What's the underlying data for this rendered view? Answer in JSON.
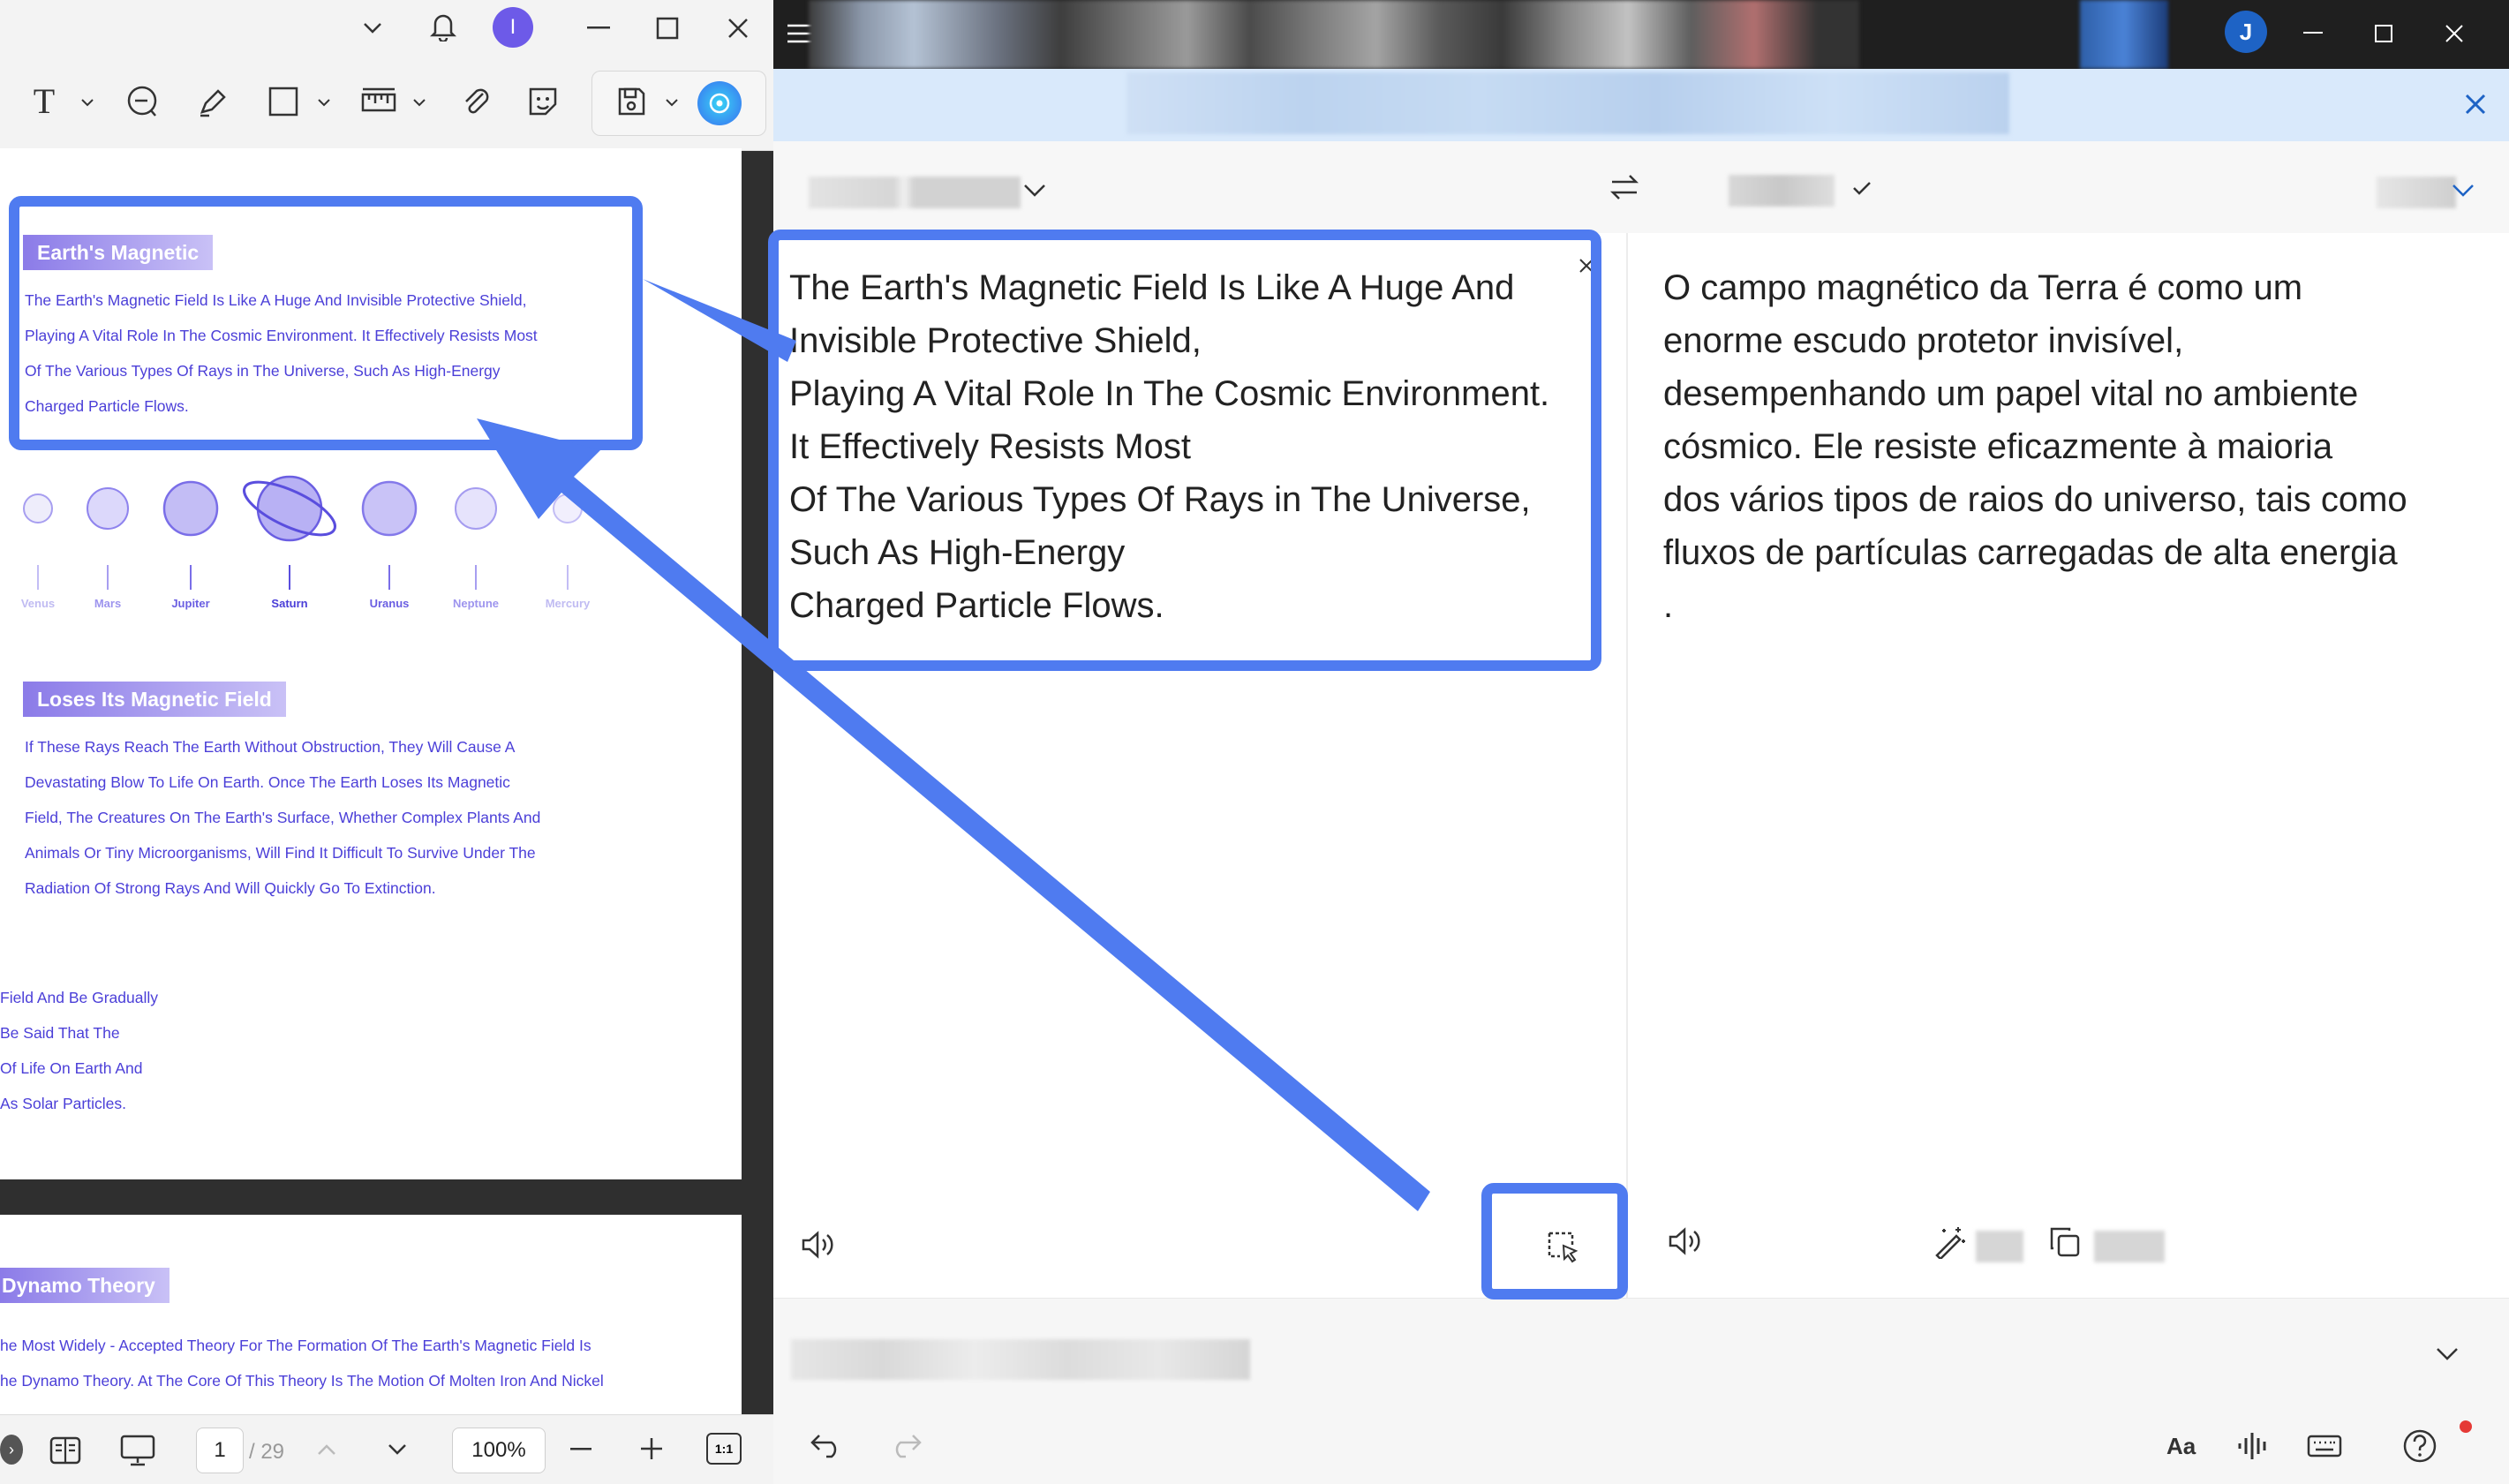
{
  "left_app": {
    "toolbar": {
      "text_tool": "T",
      "page_current": "1",
      "page_total": "/ 29",
      "zoom": "100%",
      "fit_label": "1:1",
      "profile_initial": "I"
    },
    "pdf": {
      "section1_title": "Earth's Magnetic",
      "section1_lines": [
        "The Earth's Magnetic Field Is Like A Huge And Invisible Protective Shield,",
        "Playing A Vital Role In The Cosmic Environment. It Effectively Resists Most",
        "Of The Various Types Of Rays in The Universe, Such As High-Energy",
        "Charged Particle Flows."
      ],
      "planets": [
        "Venus",
        "Mars",
        "Jupiter",
        "Saturn",
        "Uranus",
        "Neptune",
        "Mercury"
      ],
      "section2_title": "Loses Its Magnetic Field",
      "section2_lines": [
        "If These Rays Reach The Earth Without Obstruction, They Will Cause A",
        "Devastating Blow To Life On Earth. Once The Earth Loses Its Magnetic",
        "Field, The Creatures On The Earth's Surface, Whether Complex Plants And",
        "Animals Or Tiny Microorganisms, Will Find It Difficult To Survive Under The",
        "Radiation Of Strong Rays And Will Quickly Go To Extinction."
      ],
      "section3_lines": [
        "Field And Be Gradually",
        " Be Said That The",
        "Of Life On Earth And",
        " As Solar Particles."
      ],
      "section4_title": "Dynamo Theory",
      "section4_lines": [
        "he Most Widely - Accepted Theory For The Formation Of The Earth's Magnetic Field Is",
        "he Dynamo Theory. At The Core Of This Theory Is The Motion Of Molten Iron And Nickel"
      ]
    }
  },
  "right_app": {
    "profile_initial": "J",
    "source_lines": [
      "The Earth's Magnetic Field Is Like A Huge And",
      "Invisible Protective Shield,",
      "Playing A Vital Role In The Cosmic Environment.",
      "It Effectively Resists Most",
      "Of The Various Types Of Rays in The Universe,",
      "Such As High-Energy",
      "Charged Particle Flows."
    ],
    "target_lines": [
      "O campo magnético da Terra é como um",
      "enorme escudo protetor invisível,",
      "desempenhando um papel vital no ambiente",
      "cósmico. Ele resiste eficazmente à maioria",
      "dos vários tipos de raios do universo, tais como",
      "fluxos de partículas carregadas de alta energia",
      "."
    ],
    "font_size_label": "Aa"
  },
  "colors": {
    "highlight": "#4f7bf0",
    "pdf_text": "#4b3fd8",
    "chip_start": "#8b7be8",
    "planet_fill": "#c3bdf5"
  }
}
